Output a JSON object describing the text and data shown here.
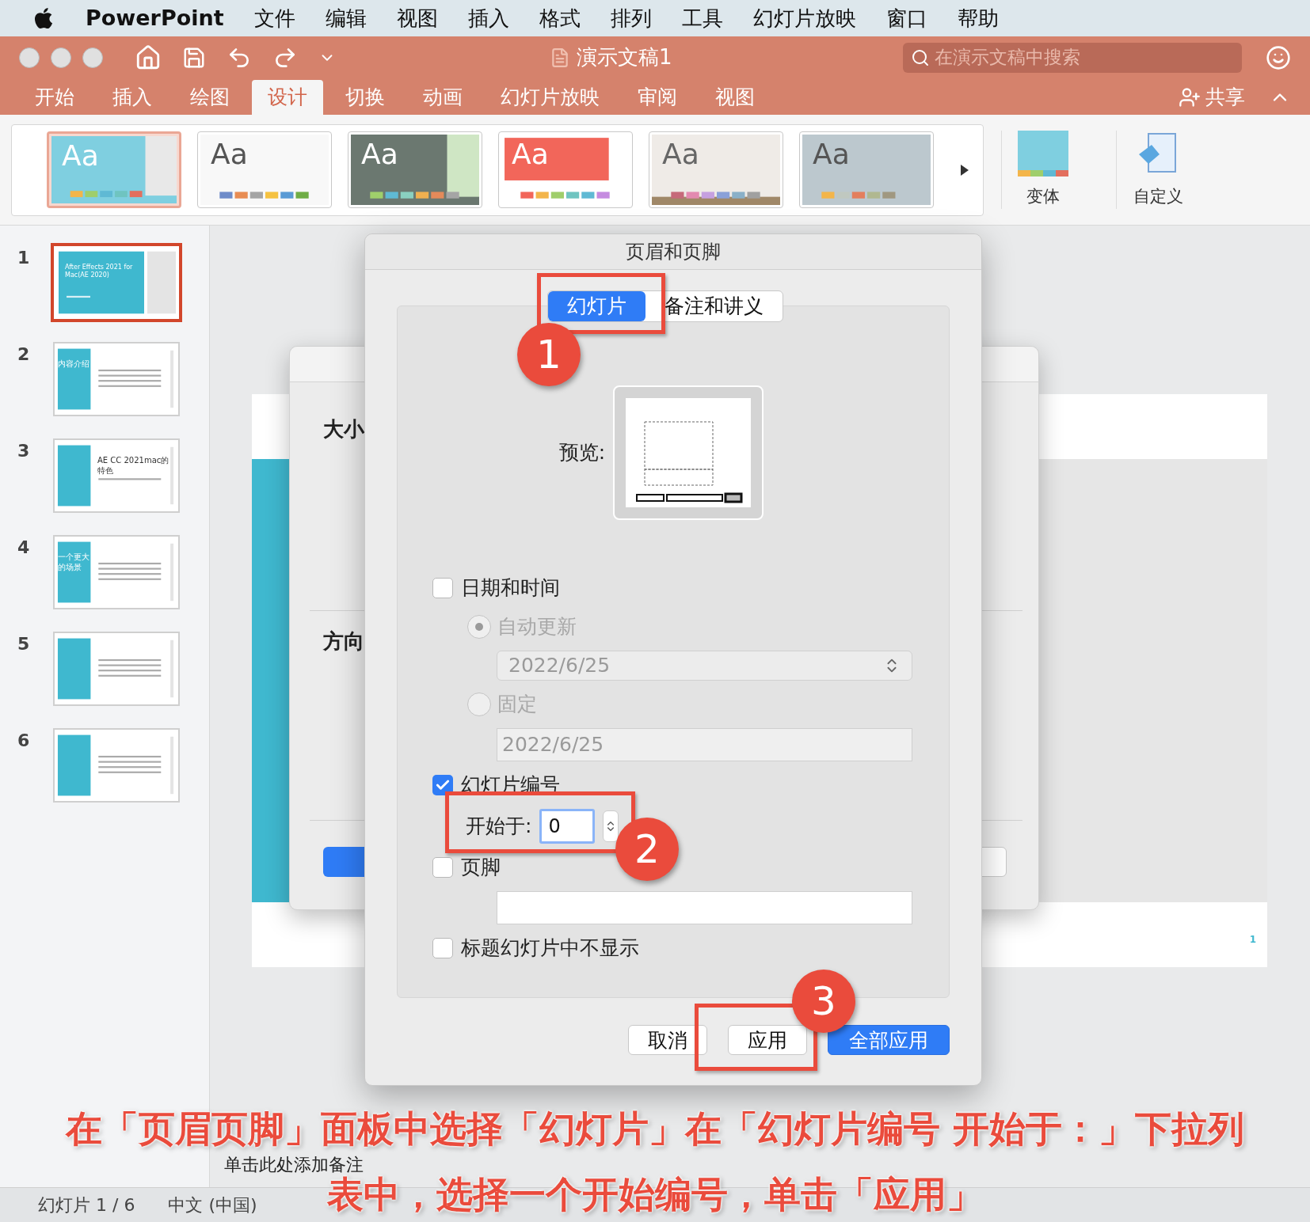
{
  "menu_bar": {
    "app": "PowerPoint",
    "items": [
      "文件",
      "编辑",
      "视图",
      "插入",
      "格式",
      "排列",
      "工具",
      "幻灯片放映",
      "窗口",
      "帮助"
    ]
  },
  "title_bar": {
    "doc_title": "演示文稿1",
    "search": {
      "placeholder": "在演示文稿中搜索"
    }
  },
  "ribbon_tabs": [
    {
      "label": "开始",
      "selected": false
    },
    {
      "label": "插入",
      "selected": false
    },
    {
      "label": "绘图",
      "selected": false
    },
    {
      "label": "设计",
      "selected": true
    },
    {
      "label": "切换",
      "selected": false
    },
    {
      "label": "动画",
      "selected": false
    },
    {
      "label": "幻灯片放映",
      "selected": false
    },
    {
      "label": "审阅",
      "selected": false
    },
    {
      "label": "视图",
      "selected": false
    }
  ],
  "share": "共享",
  "themes": [
    {
      "label": "Aa",
      "kind": "teal",
      "selected": true
    },
    {
      "label": "Aa",
      "kind": "white",
      "selected": false
    },
    {
      "label": "Aa",
      "kind": "dark",
      "selected": false
    },
    {
      "label": "Aa",
      "kind": "red",
      "selected": false
    },
    {
      "label": "Aa",
      "kind": "beige",
      "selected": false
    },
    {
      "label": "Aa",
      "kind": "grey",
      "selected": false
    }
  ],
  "ribbon_buttons": [
    {
      "label": "变体",
      "kind": "variants"
    },
    {
      "label": "自定义",
      "kind": "customize"
    }
  ],
  "slides": [
    {
      "number": "1",
      "selected": true,
      "kind": "title",
      "title": "After Effects 2021 for Mac(AE 2020)"
    },
    {
      "number": "2",
      "selected": false,
      "kind": "section",
      "title": "内容介绍"
    },
    {
      "number": "3",
      "selected": false,
      "kind": "section-text",
      "title": "AE CC 2021mac的特色"
    },
    {
      "number": "4",
      "selected": false,
      "kind": "section",
      "title": "一个更大的场景"
    },
    {
      "number": "5",
      "selected": false,
      "kind": "section"
    },
    {
      "number": "6",
      "selected": false,
      "kind": "section"
    }
  ],
  "slide_size_dialog": {
    "labels": [
      "大小",
      "方向"
    ]
  },
  "slide_footer": "1",
  "dialog": {
    "title": "页眉和页脚",
    "tabs": [
      {
        "label": "幻灯片",
        "selected": true
      },
      {
        "label": "备注和讲义",
        "selected": false
      }
    ],
    "preview_label": "预览:",
    "options": [
      {
        "kind": "checkbox",
        "label": "日期和时间",
        "checked": false
      },
      {
        "kind": "radio",
        "label": "自动更新",
        "selected": true,
        "disabled": true
      },
      {
        "kind": "select",
        "value": "2022/6/25",
        "disabled": true
      },
      {
        "kind": "radio",
        "label": "固定",
        "selected": false,
        "disabled": true
      },
      {
        "kind": "field",
        "value": "2022/6/25",
        "disabled": true
      },
      {
        "kind": "checkbox",
        "label": "幻灯片编号",
        "checked": true
      },
      {
        "kind": "spinner",
        "label": "开始于:",
        "value": "0"
      },
      {
        "kind": "checkbox",
        "label": "页脚",
        "checked": false
      },
      {
        "kind": "field",
        "disabled": false
      },
      {
        "kind": "checkbox",
        "label": "标题幻灯片中不显示",
        "checked": false
      }
    ],
    "buttons": [
      {
        "label": "取消",
        "kind": "normal"
      },
      {
        "label": "应用",
        "kind": "normal"
      },
      {
        "label": "全部应用",
        "kind": "default"
      }
    ]
  },
  "notes_placeholder": "单击此处添加备注",
  "status_bar": [
    "幻灯片 1 / 6",
    "中文 (中国)"
  ],
  "annotations": {
    "markers": [
      "1",
      "2",
      "3"
    ],
    "caption": [
      "在「页眉页脚」面板中选择「幻灯片」在「幻灯片编号 开始于：」下拉列",
      "表中，选择一个开始编号，单击「应用」"
    ]
  }
}
